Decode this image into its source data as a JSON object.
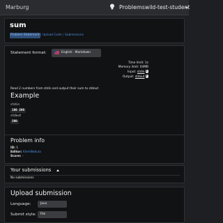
{
  "navbar": {
    "brand": "Marburg",
    "problems_label": "Problems",
    "user": "wild-test-student"
  },
  "problem": {
    "title": "sum",
    "tabs": [
      "Problem Statement",
      "Upload Code",
      "Submissions"
    ]
  },
  "statement": {
    "format_label": "Statement format:",
    "format_value": "English - Markdown",
    "time_limit": "Time limit: 1s",
    "memory_limit": "Memory limit: 64MB",
    "input_prefix": "Input:",
    "input_value": "stdin",
    "output_prefix": "Output:",
    "output_value": "stdout",
    "text": "Read 2 numbers from stdin and output their sum to stdout",
    "example_heading": "Example",
    "stdin_label": "stdin",
    "stdin_lines": [
      "100 200"
    ],
    "stdout_label": "stdout",
    "stdout_lines": [
      "300"
    ]
  },
  "problem_info": {
    "heading": "Problem info",
    "id_label": "ID:",
    "id_value": "1",
    "editor_label": "Editor:",
    "editor_value": "KlemNebula",
    "score_label": "Score:",
    "score_value": "-"
  },
  "submissions": {
    "heading": "Your submissions",
    "empty_text": "No submissions"
  },
  "upload": {
    "heading": "Upload submission",
    "language_label": "Language:",
    "language_value": "Java",
    "style_label": "Submit style:",
    "style_value": "File"
  }
}
